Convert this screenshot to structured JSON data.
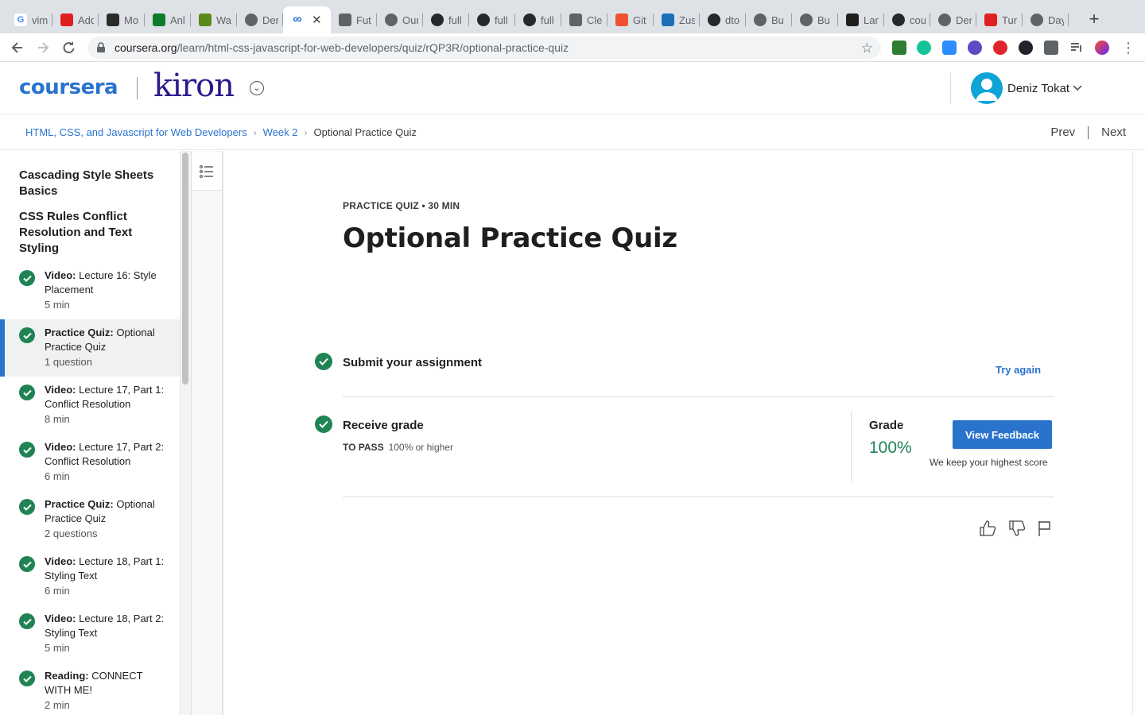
{
  "browser": {
    "tabs": [
      {
        "title": "vim",
        "favicon": "google-icon",
        "color": "#ffffff"
      },
      {
        "title": "Add",
        "favicon": "il-icon",
        "color": "#e02020"
      },
      {
        "title": "Mo",
        "favicon": "colorblocks-icon",
        "color": "#2b2b2b"
      },
      {
        "title": "Anl",
        "favicon": "u-icon",
        "color": "#0b7d2a"
      },
      {
        "title": "Wa",
        "favicon": "ru-icon",
        "color": "#5a8a1a"
      },
      {
        "title": "Der",
        "favicon": "globe-icon",
        "color": "#5f6368"
      },
      {
        "title": "",
        "favicon": "coursera-icon",
        "color": "#2a73cc",
        "active": true
      },
      {
        "title": "Fut",
        "favicon": "store-icon",
        "color": "#5f6368"
      },
      {
        "title": "Our",
        "favicon": "globe-icon",
        "color": "#5f6368"
      },
      {
        "title": "full",
        "favicon": "github-icon",
        "color": "#24292e"
      },
      {
        "title": "full",
        "favicon": "github-icon",
        "color": "#24292e"
      },
      {
        "title": "full",
        "favicon": "github-icon",
        "color": "#24292e"
      },
      {
        "title": "Cle",
        "favicon": "clean-icon",
        "color": "#5f6368"
      },
      {
        "title": "Git",
        "favicon": "git-icon",
        "color": "#f05032"
      },
      {
        "title": "Zus",
        "favicon": "zus-icon",
        "color": "#1b6fb8"
      },
      {
        "title": "dto",
        "favicon": "github-icon",
        "color": "#24292e"
      },
      {
        "title": "Bu",
        "favicon": "globe-icon",
        "color": "#5f6368"
      },
      {
        "title": "Bu",
        "favicon": "globe-icon",
        "color": "#5f6368"
      },
      {
        "title": "Lar",
        "favicon": "lt-icon",
        "color": "#1f1f1f"
      },
      {
        "title": "cou",
        "favicon": "github-icon",
        "color": "#24292e"
      },
      {
        "title": "Der",
        "favicon": "globe-icon",
        "color": "#5f6368"
      },
      {
        "title": "Tur",
        "favicon": "i-icon",
        "color": "#e02020"
      },
      {
        "title": "Day",
        "favicon": "globe-icon",
        "color": "#5f6368"
      }
    ],
    "url_host": "coursera.org",
    "url_path": "/learn/html-css-javascript-for-web-developers/quiz/rQP3R/optional-practice-quiz"
  },
  "header": {
    "brand": "coursera",
    "partner": "kiron",
    "user_name": "Deniz Tokat"
  },
  "breadcrumb": {
    "course": "HTML, CSS, and Javascript for Web Developers",
    "week": "Week 2",
    "current": "Optional Practice Quiz",
    "prev": "Prev",
    "next": "Next"
  },
  "sidebar": {
    "section_1": "Cascading Style Sheets Basics",
    "section_2": "CSS Rules Conflict Resolution and Text Styling",
    "items": [
      {
        "kind": "Video:",
        "title": "Lecture 16: Style Placement",
        "duration": "5 min"
      },
      {
        "kind": "Practice Quiz:",
        "title": "Optional Practice Quiz",
        "duration": "1 question",
        "active": true
      },
      {
        "kind": "Video:",
        "title": "Lecture 17, Part 1: Conflict Resolution",
        "duration": "8 min"
      },
      {
        "kind": "Video:",
        "title": "Lecture 17, Part 2: Conflict Resolution",
        "duration": "6 min"
      },
      {
        "kind": "Practice Quiz:",
        "title": "Optional Practice Quiz",
        "duration": "2 questions"
      },
      {
        "kind": "Video:",
        "title": "Lecture 18, Part 1: Styling Text",
        "duration": "6 min"
      },
      {
        "kind": "Video:",
        "title": "Lecture 18, Part 2: Styling Text",
        "duration": "5 min"
      },
      {
        "kind": "Reading:",
        "title": "CONNECT WITH ME!",
        "duration": "2 min"
      }
    ]
  },
  "main": {
    "eyebrow": "PRACTICE QUIZ • 30 MIN",
    "title": "Optional Practice Quiz",
    "submit_title": "Submit your assignment",
    "try_again": "Try again",
    "receive_title": "Receive grade",
    "to_pass_label": "TO PASS",
    "to_pass_value": "100% or higher",
    "grade_label": "Grade",
    "grade_value": "100%",
    "view_feedback": "View Feedback",
    "keep_note": "We keep your highest score"
  },
  "colors": {
    "accent": "#2a73cc",
    "success": "#1f8354",
    "kiron": "#2b1b8c"
  }
}
